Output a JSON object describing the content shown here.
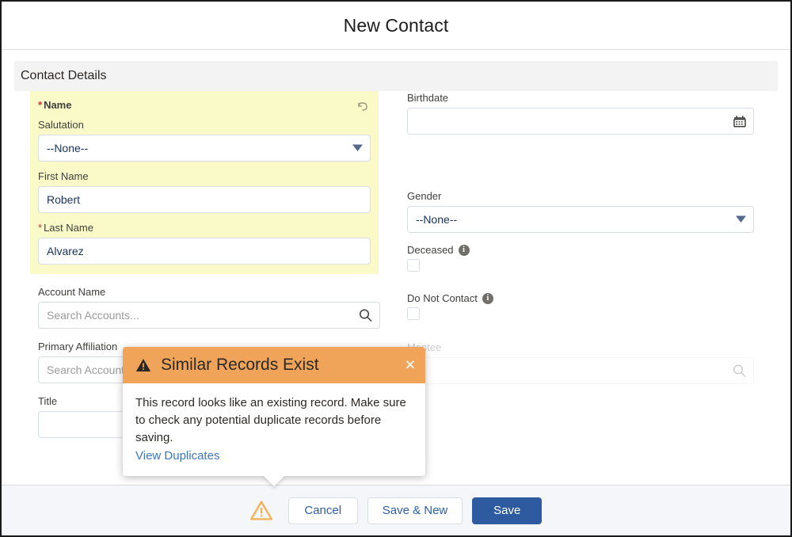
{
  "modal": {
    "title": "New Contact"
  },
  "section": {
    "title": "Contact Details"
  },
  "name_group": {
    "label": "Name",
    "required": true,
    "revert_icon": "undo-arrow-icon",
    "fields": {
      "salutation": {
        "label": "Salutation",
        "value": "--None--",
        "icon": "chevron-down-icon"
      },
      "first_name": {
        "label": "First Name",
        "value": "Robert"
      },
      "last_name": {
        "label": "Last Name",
        "required": true,
        "value": "Alvarez"
      }
    }
  },
  "left_fields": {
    "account_name": {
      "label": "Account Name",
      "placeholder": "Search Accounts...",
      "value": "",
      "icon": "search-icon"
    },
    "primary_affiliation": {
      "label": "Primary Affiliation",
      "placeholder": "Search Accounts...",
      "value": "",
      "icon": "search-icon"
    },
    "title": {
      "label": "Title",
      "value": ""
    }
  },
  "right_fields": {
    "birthdate": {
      "label": "Birthdate",
      "value": "",
      "icon": "calendar-icon"
    },
    "gender": {
      "label": "Gender",
      "value": "--None--",
      "icon": "chevron-down-icon"
    },
    "deceased": {
      "label": "Deceased",
      "checked": false,
      "info_icon": "info-icon",
      "info_glyph": "i"
    },
    "do_not_contact": {
      "label": "Do Not Contact",
      "checked": false,
      "info_icon": "info-icon",
      "info_glyph": "i"
    },
    "mentee": {
      "label": "Mentee",
      "placeholder": "",
      "value": "",
      "icon": "search-icon"
    }
  },
  "popover": {
    "title": "Similar Records Exist",
    "warning_icon": "warning-triangle-icon",
    "close_icon": "close-icon",
    "close_glyph": "✕",
    "body": "This record looks like an existing record. Make sure to check any potential duplicate records before saving.",
    "link": "View Duplicates"
  },
  "footer": {
    "warning_icon": "warning-triangle-icon",
    "cancel": "Cancel",
    "save_new": "Save & New",
    "save": "Save"
  },
  "colors": {
    "accent_blue": "#2e5aa0",
    "link_blue": "#3b74c4",
    "warning_orange": "#efa45a",
    "highlight_yellow": "#fafac8",
    "required_red": "#c23934",
    "footer_bg": "#f4f6f9",
    "section_bg": "#f3f3f3"
  }
}
